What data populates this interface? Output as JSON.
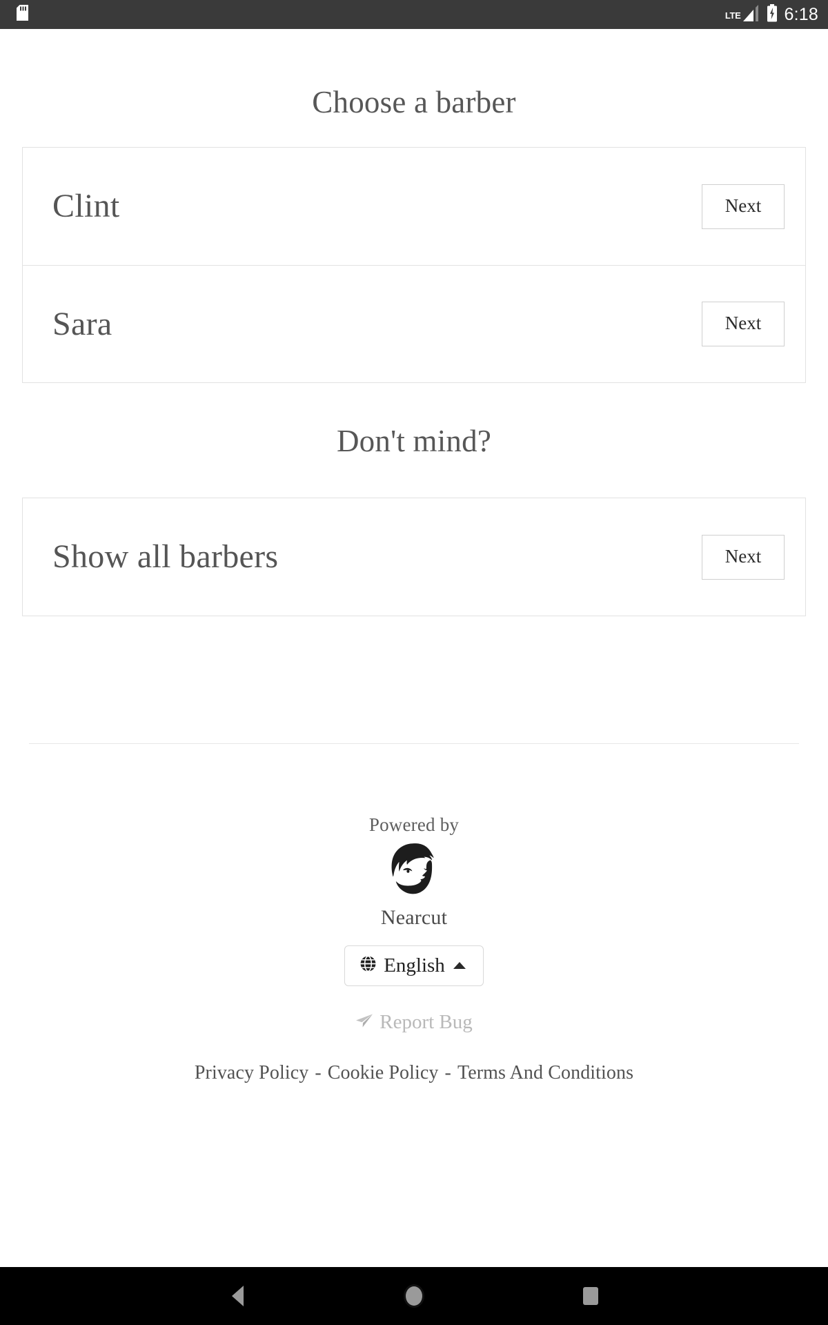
{
  "status_bar": {
    "sd_card_icon": "sd-card-icon",
    "network_label": "LTE",
    "signal_icon": "signal-bars-icon",
    "battery_icon": "battery-charging-icon",
    "time": "6:18"
  },
  "page": {
    "title": "Choose a barber",
    "fallback_heading": "Don't mind?"
  },
  "barbers": [
    {
      "name": "Clint",
      "action_label": "Next"
    },
    {
      "name": "Sara",
      "action_label": "Next"
    }
  ],
  "fallback_option": {
    "name": "Show all barbers",
    "action_label": "Next"
  },
  "footer": {
    "powered_by": "Powered by",
    "brand_name": "Nearcut",
    "brand_logo_icon": "bearded-man-logo-icon",
    "language": {
      "globe_icon": "globe-icon",
      "label": "English",
      "caret_icon": "caret-up-icon"
    },
    "report_bug": {
      "icon": "send-paper-plane-icon",
      "label": "Report Bug"
    },
    "legal": {
      "privacy": "Privacy Policy",
      "separator_1": "-",
      "cookie": "Cookie Policy",
      "separator_2": "-",
      "terms": "Terms And Conditions"
    }
  },
  "nav_bar": {
    "back_icon": "back-triangle-icon",
    "home_icon": "home-circle-icon",
    "recents_icon": "recents-square-icon"
  },
  "colors": {
    "status_bar_bg": "#3a3a3a",
    "nav_bar_bg": "#000000",
    "page_bg": "#ffffff",
    "text_primary": "#555555",
    "border": "#e2e2e2",
    "muted": "#b9b9b9"
  }
}
